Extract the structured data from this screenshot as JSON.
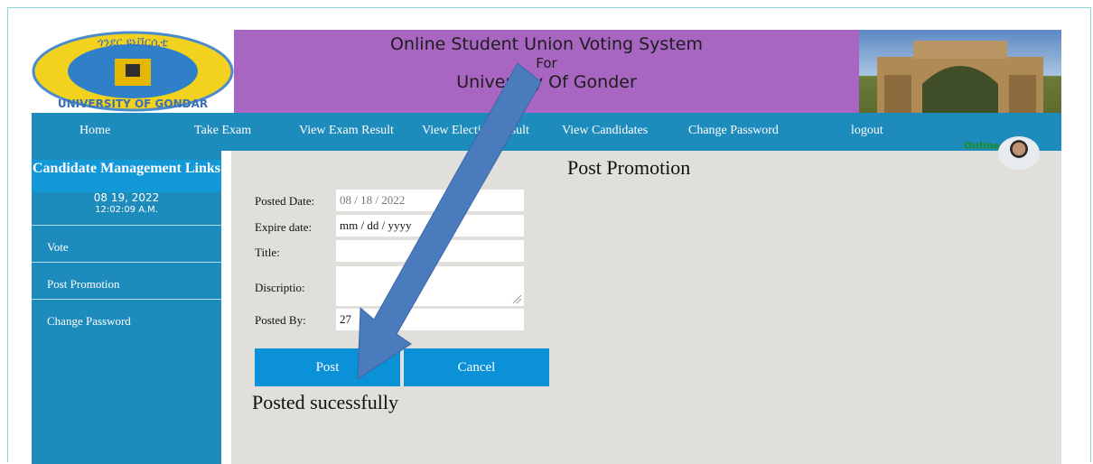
{
  "header": {
    "banner_line1": "Online Student Union Voting System",
    "banner_line2": "For",
    "banner_line3": "University Of Gonder",
    "logo_text_top": "ጎንደር ዩኒቨርሲቲ",
    "logo_text_bottom": "UNIVERSITY OF GONDAR"
  },
  "nav": {
    "items": [
      "Home",
      "Take Exam",
      "View Exam Result",
      "View Election Result",
      "View Candidates",
      "Change Password",
      "logout"
    ],
    "online_label": "Online"
  },
  "sidebar": {
    "heading": "Candidate Management Links",
    "date": "08 19, 2022",
    "time": "12:02:09 A.M.",
    "items": [
      "Vote",
      "Post Promotion",
      "Change Password"
    ]
  },
  "form": {
    "title": "Post Promotion",
    "posted_date_label": "Posted Date:",
    "posted_date_value": "08 / 18 / 2022",
    "expire_date_label": "Expire date:",
    "expire_date_placeholder": "mm / dd / yyyy",
    "title_label": "Title:",
    "description_label": "Discriptio:",
    "posted_by_label": "Posted By:",
    "posted_by_value": "27",
    "post_button": "Post",
    "cancel_button": "Cancel",
    "status_message": "Posted sucessfully"
  },
  "colors": {
    "nav": "#1e8bbd",
    "banner": "#a866c2",
    "button": "#0a91d8",
    "main_bg": "#e0dfdc",
    "arrow": "#4a7bbd"
  }
}
